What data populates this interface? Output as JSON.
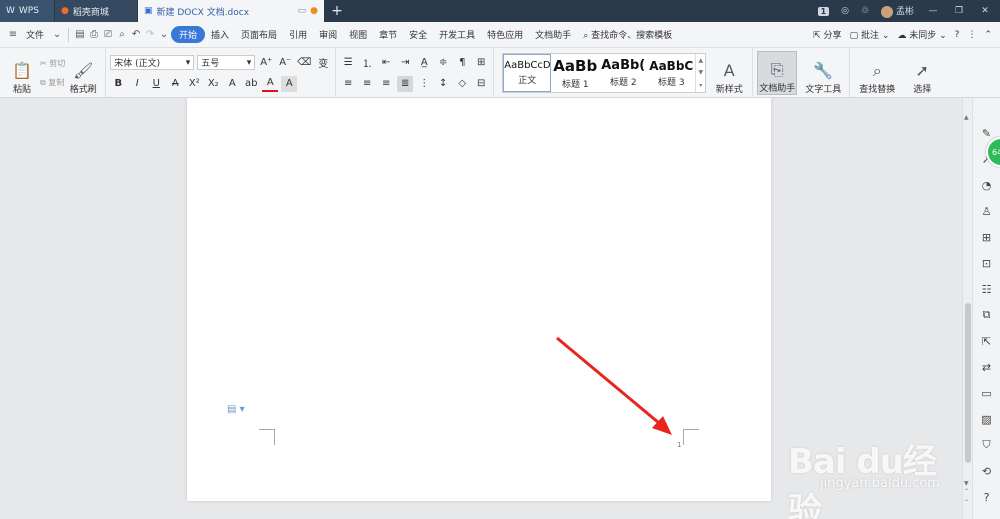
{
  "titlebar": {
    "tabs": [
      {
        "label": "WPS",
        "icon": "wps-logo-icon"
      },
      {
        "label": "稻壳商城",
        "icon": "docer-icon"
      },
      {
        "label": "新建 DOCX 文档.docx",
        "icon": "writer-doc-icon"
      }
    ],
    "add_tab": "+",
    "page_badge": "1",
    "username": "孟彬",
    "controls": [
      "—",
      "❐",
      "✕"
    ]
  },
  "menubar": {
    "file": "文件",
    "tabs": [
      "开始",
      "插入",
      "页面布局",
      "引用",
      "审阅",
      "视图",
      "章节",
      "安全",
      "开发工具",
      "特色应用",
      "文档助手"
    ],
    "active_tab": "开始",
    "search": "查找命令、搜索模板",
    "share": "分享",
    "comment": "批注",
    "sync": "未同步",
    "help": "?"
  },
  "ribbon": {
    "paste": "粘贴",
    "cut": "剪切",
    "copy": "复制",
    "format_painter": "格式刷",
    "font_name": "宋体 (正文)",
    "font_size": "五号",
    "styles": [
      {
        "sample": "AaBbCcDd",
        "label": "正文"
      },
      {
        "sample": "AaBb",
        "label": "标题 1"
      },
      {
        "sample": "AaBb(",
        "label": "标题 2"
      },
      {
        "sample": "AaBbC",
        "label": "标题 3"
      }
    ],
    "new_style": "新样式",
    "doc_assistant": "文档助手",
    "text_tools": "文字工具",
    "find_replace": "查找替换",
    "select": "选择"
  },
  "document": {
    "page_number": "1"
  },
  "watermark": {
    "brand": "Bai du经验",
    "url": "jingyan.baidu.com"
  },
  "colors": {
    "titlebar": "#2b3a4a",
    "accent": "#3a78d8",
    "arrow": "#e8261f",
    "assistant_green": "#2fbb5a"
  }
}
